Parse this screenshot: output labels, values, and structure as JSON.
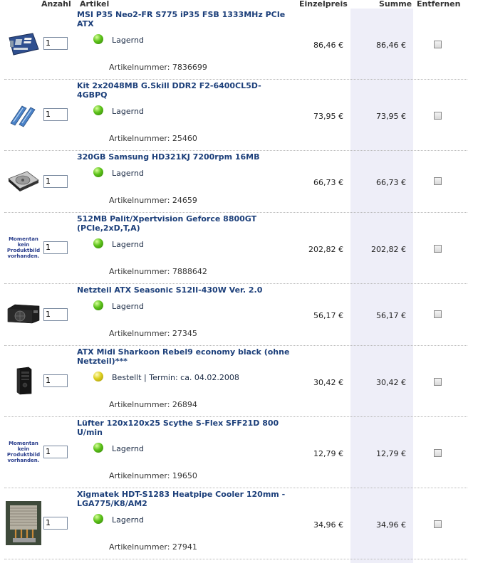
{
  "columns": {
    "anzahl": "Anzahl",
    "artikel": "Artikel",
    "einzelpreis": "Einzelpreis",
    "summe": "Summe",
    "entfernen": "Entfernen"
  },
  "no_image_text": "Momentan kein Produktbild vorhanden.",
  "items": [
    {
      "title": "MSI P35 Neo2-FR S775 iP35 FSB 1333MHz PCIe ATX",
      "qty": "1",
      "status": "Lagernd",
      "status_color": "green",
      "artno": "Artikelnummer: 7836699",
      "unit_price": "86,46 €",
      "sum": "86,46 €",
      "icon": "motherboard-icon"
    },
    {
      "title": "Kit 2x2048MB G.Skill DDR2 F2-6400CL5D-4GBPQ",
      "qty": "1",
      "status": "Lagernd",
      "status_color": "green",
      "artno": "Artikelnummer: 25460",
      "unit_price": "73,95 €",
      "sum": "73,95 €",
      "icon": "ram-icon"
    },
    {
      "title": "320GB Samsung HD321KJ 7200rpm 16MB",
      "qty": "1",
      "status": "Lagernd",
      "status_color": "green",
      "artno": "Artikelnummer: 24659",
      "unit_price": "66,73 €",
      "sum": "66,73 €",
      "icon": "harddisk-icon"
    },
    {
      "title": "512MB Palit/Xpertvision Geforce 8800GT (PCIe,2xD,T,A)",
      "qty": "1",
      "status": "Lagernd",
      "status_color": "green",
      "artno": "Artikelnummer: 7888642",
      "unit_price": "202,82 €",
      "sum": "202,82 €",
      "icon": "no-image"
    },
    {
      "title": "Netzteil ATX Seasonic S12II-430W Ver. 2.0",
      "qty": "1",
      "status": "Lagernd",
      "status_color": "green",
      "artno": "Artikelnummer: 27345",
      "unit_price": "56,17 €",
      "sum": "56,17 €",
      "icon": "psu-icon"
    },
    {
      "title": "ATX Midi Sharkoon Rebel9 economy black (ohne Netzteil)***",
      "qty": "1",
      "status": "Bestellt | Termin: ca. 04.02.2008",
      "status_color": "yellow",
      "artno": "Artikelnummer: 26894",
      "unit_price": "30,42 €",
      "sum": "30,42 €",
      "icon": "pc-case-icon"
    },
    {
      "title": "Lüfter 120x120x25 Scythe S-Flex SFF21D 800 U/min",
      "qty": "1",
      "status": "Lagernd",
      "status_color": "green",
      "artno": "Artikelnummer: 19650",
      "unit_price": "12,79 €",
      "sum": "12,79 €",
      "icon": "no-image"
    },
    {
      "title": "Xigmatek HDT-S1283 Heatpipe Cooler 120mm - LGA775/K8/AM2",
      "qty": "1",
      "status": "Lagernd",
      "status_color": "green",
      "artno": "Artikelnummer: 27941",
      "unit_price": "34,96 €",
      "sum": "34,96 €",
      "icon": "cpu-cooler-icon"
    }
  ]
}
